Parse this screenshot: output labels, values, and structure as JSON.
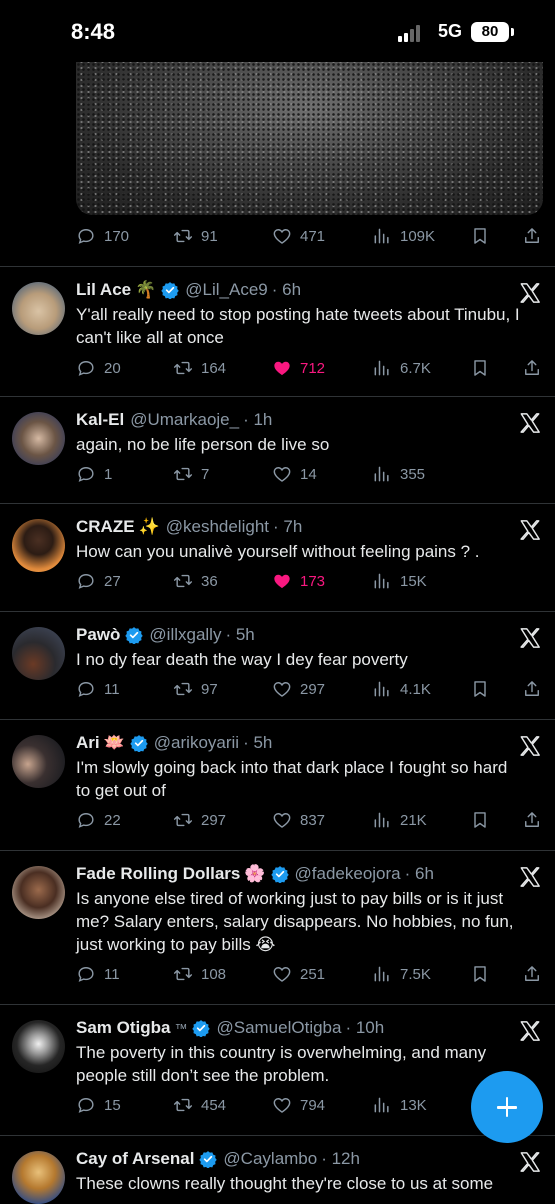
{
  "status": {
    "time": "8:48",
    "network": "5G",
    "battery": "80"
  },
  "top_post": {
    "image": "crowd-photo",
    "reply": "170",
    "retweet": "91",
    "like": "471",
    "views": "109K"
  },
  "tweets": [
    {
      "name": "Lil Ace",
      "emoji": "🌴",
      "verified": true,
      "handle": "@Lil_Ace9",
      "time": "· 6h",
      "text": "Y'all really need to stop posting hate tweets about Tinubu, I can't like all at once",
      "reply": "20",
      "retweet": "164",
      "like": "712",
      "liked": true,
      "views": "6.7K"
    },
    {
      "name": "Kal-El",
      "emoji": "",
      "verified": false,
      "handle": "@Umarkaoje_",
      "time": "· 1h",
      "text": "again, no be life person de live so",
      "reply": "1",
      "retweet": "7",
      "like": "14",
      "liked": false,
      "views": "355"
    },
    {
      "name": "CRAZE",
      "emoji": "✨",
      "verified": false,
      "handle": "@keshdelight",
      "time": "· 7h",
      "text": "How can you unalivè yourself without feeling pains ? .",
      "reply": "27",
      "retweet": "36",
      "like": "173",
      "liked": true,
      "views": "15K"
    },
    {
      "name": "Pawò",
      "emoji": "",
      "verified": true,
      "handle": "@illxgally",
      "time": "· 5h",
      "text": "I no dy fear death the way I dey fear poverty",
      "reply": "11",
      "retweet": "97",
      "like": "297",
      "liked": false,
      "views": "4.1K"
    },
    {
      "name": "Ari",
      "emoji": "🪷",
      "verified": true,
      "handle": "@arikoyarii",
      "time": "· 5h",
      "text": "I'm slowly going back into that dark place I fought so hard to get out of",
      "reply": "22",
      "retweet": "297",
      "like": "837",
      "liked": false,
      "views": "21K"
    },
    {
      "name": "Fade Rolling Dollars",
      "emoji": "🌸",
      "verified": true,
      "handle": "@fadekeojora",
      "time": "· 6h",
      "text": "Is anyone else tired of working just to pay bills or is it just me? Salary enters, salary disappears. No hobbies, no fun, just working to pay bills 😭",
      "reply": "11",
      "retweet": "108",
      "like": "251",
      "liked": false,
      "views": "7.5K"
    },
    {
      "name": "Sam Otigba",
      "emoji": "™",
      "verified": true,
      "handle": "@SamuelOtigba",
      "time": "· 10h",
      "text": "The poverty in this country is overwhelming, and many people still don’t see the problem.",
      "reply": "15",
      "retweet": "454",
      "like": "794",
      "liked": false,
      "views": "13K"
    },
    {
      "name": "Cay of Arsenal",
      "emoji": "",
      "verified": true,
      "handle": "@Caylambo",
      "time": "· 12h",
      "text": "These clowns really thought they're close to us at some",
      "reply": "",
      "retweet": "",
      "like": "",
      "liked": false,
      "views": ""
    }
  ],
  "colors": {
    "accent": "#1d9bf0",
    "like": "#f91880",
    "muted": "#8b98a5",
    "text": "#e7e9ea",
    "background": "#000000"
  }
}
